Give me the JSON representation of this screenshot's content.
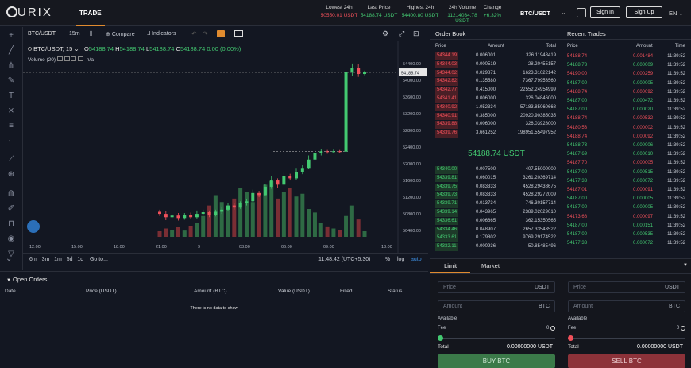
{
  "topbar": {
    "logo_text": "URIX",
    "nav_trade": "TRADE",
    "stats": [
      {
        "label": "Lowest 24h",
        "value": "50550.01 USDT",
        "color": "red"
      },
      {
        "label": "Last Price",
        "value": "54188.74 USDT",
        "color": "green"
      },
      {
        "label": "Highest 24h",
        "value": "54400.80 USDT",
        "color": "green"
      },
      {
        "label": "24h Volume",
        "value": "11214034.78 USDT",
        "color": "green"
      },
      {
        "label": "Change",
        "value": "+6.32%",
        "color": "green"
      }
    ],
    "pair": "BTC/USDT",
    "signin": "Sign In",
    "signup": "Sign Up",
    "language": "EN"
  },
  "charthead": {
    "pair": "BTC/USDT",
    "interval": "15m",
    "compare": "Compare",
    "indicators": "Indicators"
  },
  "legend": {
    "symbol": "BTC/USDT, 15",
    "o_label": "O",
    "o": "54188.74",
    "h_label": "H",
    "h": "54188.74",
    "l_label": "L",
    "l": "54188.74",
    "c_label": "C",
    "c": "54188.74",
    "change": "0.00 (0.00%)",
    "volume": "Volume (20)",
    "volume_value": "n/a"
  },
  "chart_data": {
    "type": "candlestick",
    "y_ticks": [
      "54400.00",
      "54000.00",
      "53600.00",
      "53200.00",
      "52800.00",
      "52400.00",
      "52000.00",
      "51600.00",
      "51200.00",
      "50800.00",
      "50400.00"
    ],
    "x_ticks": [
      "12:00",
      "15:00",
      "18:00",
      "21:00",
      "9",
      "03:00",
      "06:00",
      "09:00",
      "13:00"
    ],
    "last_price_label": "54188.74",
    "ylim": [
      50250,
      54550
    ],
    "candles": [
      {
        "o": 50850,
        "c": 50800,
        "h": 50900,
        "l": 50750
      },
      {
        "o": 50800,
        "c": 50720,
        "h": 50860,
        "l": 50650
      },
      {
        "o": 50720,
        "c": 50760,
        "h": 50800,
        "l": 50680
      },
      {
        "o": 50760,
        "c": 50700,
        "h": 50820,
        "l": 50640
      },
      {
        "o": 50700,
        "c": 50780,
        "h": 50820,
        "l": 50660
      },
      {
        "o": 50780,
        "c": 50720,
        "h": 50830,
        "l": 50680
      },
      {
        "o": 50720,
        "c": 50800,
        "h": 50880,
        "l": 50690
      },
      {
        "o": 50800,
        "c": 50840,
        "h": 50900,
        "l": 50760
      },
      {
        "o": 50840,
        "c": 50780,
        "h": 50880,
        "l": 50720
      },
      {
        "o": 50780,
        "c": 50850,
        "h": 50900,
        "l": 50740
      },
      {
        "o": 50850,
        "c": 50900,
        "h": 50960,
        "l": 50800
      },
      {
        "o": 50900,
        "c": 51000,
        "h": 51060,
        "l": 50860
      },
      {
        "o": 51000,
        "c": 50950,
        "h": 51050,
        "l": 50900
      },
      {
        "o": 50950,
        "c": 51050,
        "h": 51100,
        "l": 50920
      },
      {
        "o": 51050,
        "c": 51100,
        "h": 51160,
        "l": 51000
      },
      {
        "o": 51100,
        "c": 51300,
        "h": 51380,
        "l": 51080
      },
      {
        "o": 51300,
        "c": 51250,
        "h": 51350,
        "l": 51200
      },
      {
        "o": 51250,
        "c": 51450,
        "h": 51520,
        "l": 51220
      },
      {
        "o": 51450,
        "c": 51600,
        "h": 51700,
        "l": 51400
      },
      {
        "o": 51600,
        "c": 51500,
        "h": 51650,
        "l": 51420
      },
      {
        "o": 51500,
        "c": 51700,
        "h": 51780,
        "l": 51470
      },
      {
        "o": 51700,
        "c": 51650,
        "h": 51760,
        "l": 51600
      },
      {
        "o": 51650,
        "c": 51800,
        "h": 51900,
        "l": 51620
      },
      {
        "o": 51800,
        "c": 51900,
        "h": 51980,
        "l": 51750
      },
      {
        "o": 51900,
        "c": 52100,
        "h": 52200,
        "l": 51870
      },
      {
        "o": 52100,
        "c": 52250,
        "h": 52320,
        "l": 52050
      },
      {
        "o": 52250,
        "c": 52300,
        "h": 52350,
        "l": 52200
      },
      {
        "o": 52300,
        "c": 52280,
        "h": 52330,
        "l": 52240
      },
      {
        "o": 52280,
        "c": 52300,
        "h": 52340,
        "l": 52250
      },
      {
        "o": 52300,
        "c": 52290,
        "h": 52330,
        "l": 52260
      },
      {
        "o": 52290,
        "c": 54200,
        "h": 54350,
        "l": 52260
      },
      {
        "o": 54200,
        "c": 54300,
        "h": 54400,
        "l": 54100
      },
      {
        "o": 54300,
        "c": 54150,
        "h": 54380,
        "l": 54080
      },
      {
        "o": 54150,
        "c": 54188,
        "h": 54230,
        "l": 54120
      }
    ],
    "volumes": [
      8,
      12,
      10,
      14,
      9,
      16,
      20,
      30,
      45,
      60,
      50,
      40,
      55,
      70,
      65,
      50,
      60,
      75,
      80,
      55,
      65,
      70,
      58,
      62,
      40,
      35,
      20,
      15,
      12,
      10,
      30,
      45,
      25,
      8
    ]
  },
  "chartbottom": {
    "ranges": [
      "6m",
      "3m",
      "1m",
      "5d",
      "1d"
    ],
    "goto": "Go to...",
    "time": "11:48:42 (UTC+5:30)",
    "percent": "%",
    "log": "log",
    "auto": "auto"
  },
  "orders": {
    "title": "Open Orders",
    "columns": [
      "Date",
      "Price (USDT)",
      "Amount (BTC)",
      "Value (USDT)",
      "Filled",
      "Status"
    ],
    "empty": "There is no data to show"
  },
  "orderbook": {
    "title": "Order Book",
    "columns": [
      "Price",
      "Amount",
      "Total"
    ],
    "asks": [
      [
        "54344.19",
        "0.006001",
        "326.11948419"
      ],
      [
        "54344.03",
        "0.000519",
        "28.20455157"
      ],
      [
        "54344.02",
        "0.029871",
        "1623.31022142"
      ],
      [
        "54342.82",
        "0.135580",
        "7367.79953560"
      ],
      [
        "54342.77",
        "0.415000",
        "22552.24954999"
      ],
      [
        "54341.41",
        "0.006000",
        "326.04846000"
      ],
      [
        "54340.92",
        "1.052334",
        "57183.85060668"
      ],
      [
        "54340.91",
        "0.385000",
        "20920.90385035"
      ],
      [
        "54339.88",
        "0.006000",
        "326.03928000"
      ],
      [
        "54339.76",
        "3.661252",
        "198951.55497952"
      ]
    ],
    "last_price": "54188.74 USDT",
    "bids": [
      [
        "54340.00",
        "0.007500",
        "407.55000000"
      ],
      [
        "54339.81",
        "0.060015",
        "3261.20369714"
      ],
      [
        "54339.75",
        "0.083333",
        "4528.29438675"
      ],
      [
        "54339.73",
        "0.083333",
        "4528.29272009"
      ],
      [
        "54339.71",
        "0.013734",
        "746.30157714"
      ],
      [
        "54339.14",
        "0.043965",
        "2389.02029010"
      ],
      [
        "54336.61",
        "0.006665",
        "362.15350565"
      ],
      [
        "54334.46",
        "0.048907",
        "2657.33543522"
      ],
      [
        "54333.61",
        "0.179802",
        "9769.29174522"
      ],
      [
        "54332.11",
        "0.000936",
        "50.85485496"
      ]
    ]
  },
  "trades": {
    "title": "Recent Trades",
    "columns": [
      "Price",
      "Amount",
      "Time"
    ],
    "rows": [
      [
        "54188.74",
        "0.001484",
        "11:39:52",
        "red"
      ],
      [
        "54188.73",
        "0.000009",
        "11:39:52",
        "green"
      ],
      [
        "54190.00",
        "0.000259",
        "11:39:52",
        "red"
      ],
      [
        "54187.00",
        "0.000005",
        "11:39:52",
        "green"
      ],
      [
        "54188.74",
        "0.000092",
        "11:39:52",
        "red"
      ],
      [
        "54187.00",
        "0.000472",
        "11:39:52",
        "green"
      ],
      [
        "54187.00",
        "0.000020",
        "11:39:52",
        "green"
      ],
      [
        "54188.74",
        "0.000532",
        "11:39:52",
        "red"
      ],
      [
        "54180.53",
        "0.000002",
        "11:39:52",
        "red"
      ],
      [
        "54188.74",
        "0.000092",
        "11:39:52",
        "red"
      ],
      [
        "54188.73",
        "0.000006",
        "11:39:52",
        "green"
      ],
      [
        "54187.69",
        "0.000010",
        "11:39:52",
        "green"
      ],
      [
        "54187.70",
        "0.000005",
        "11:39:52",
        "red"
      ],
      [
        "54187.00",
        "0.000515",
        "11:39:52",
        "green"
      ],
      [
        "54177.33",
        "0.000072",
        "11:39:52",
        "green"
      ],
      [
        "54187.01",
        "0.000091",
        "11:39:52",
        "red"
      ],
      [
        "54187.00",
        "0.000005",
        "11:39:52",
        "green"
      ],
      [
        "54187.00",
        "0.000005",
        "11:39:52",
        "green"
      ],
      [
        "54173.68",
        "0.000097",
        "11:39:52",
        "red"
      ],
      [
        "54187.00",
        "0.000151",
        "11:39:52",
        "green"
      ],
      [
        "54187.00",
        "0.000535",
        "11:39:52",
        "green"
      ],
      [
        "54177.33",
        "0.000072",
        "11:39:52",
        "green"
      ]
    ]
  },
  "form": {
    "tab_limit": "Limit",
    "tab_market": "Market",
    "price": "Price",
    "amount": "Amount",
    "unit_usdt": "USDT",
    "unit_btc": "BTC",
    "available": "Available",
    "fee": "Fee",
    "fee_value": "0",
    "total": "Total",
    "total_value": "0.00000000",
    "buy": "BUY BTC",
    "sell": "SELL BTC"
  },
  "colors": {
    "up": "#43c971",
    "down": "#f0505a",
    "accent": "#e08b2f",
    "bg": "#131722"
  }
}
